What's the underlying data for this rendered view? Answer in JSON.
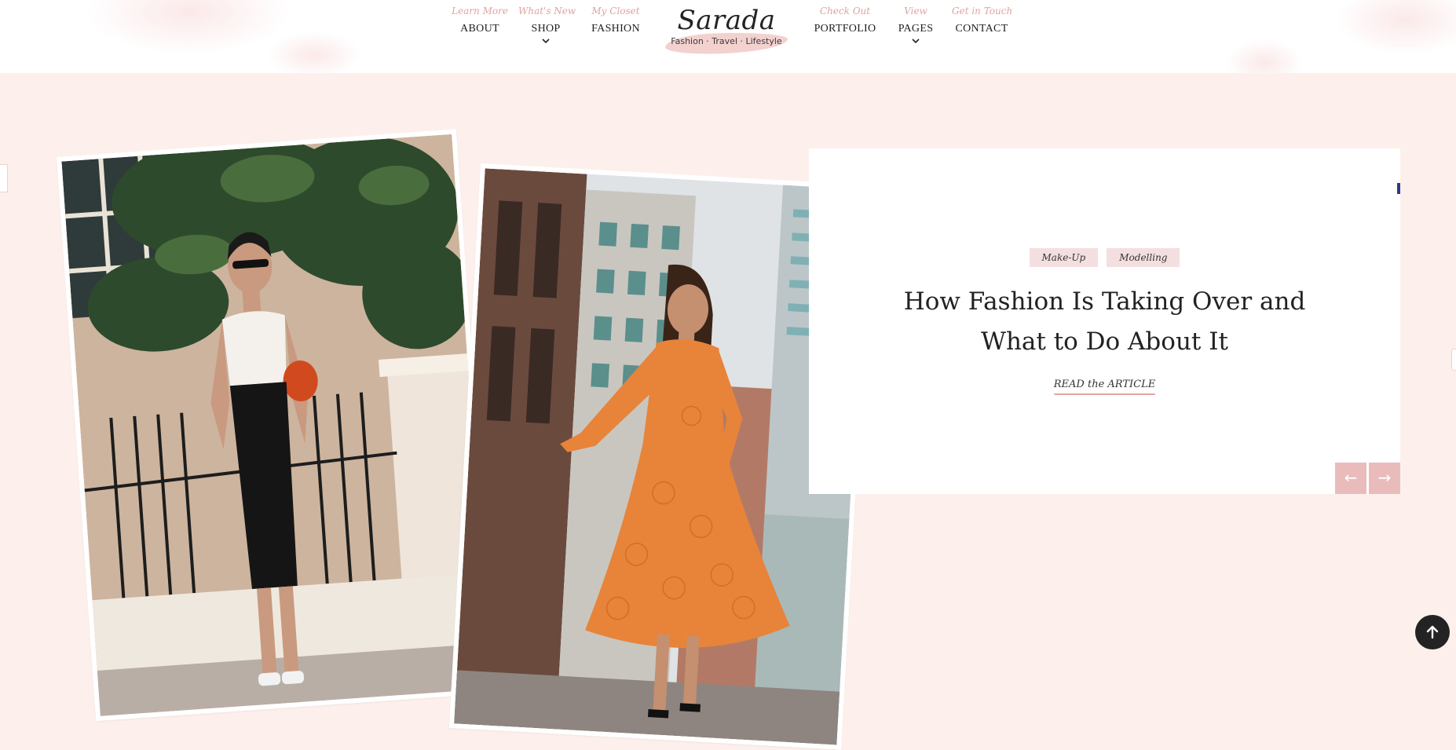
{
  "nav": {
    "items_left": [
      {
        "kicker": "Learn More",
        "label": "ABOUT",
        "has_dropdown": false
      },
      {
        "kicker": "What's New",
        "label": "SHOP",
        "has_dropdown": true
      },
      {
        "kicker": "My Closet",
        "label": "FASHION",
        "has_dropdown": false
      }
    ],
    "items_right": [
      {
        "kicker": "Check Out",
        "label": "PORTFOLIO",
        "has_dropdown": false
      },
      {
        "kicker": "View",
        "label": "PAGES",
        "has_dropdown": true
      },
      {
        "kicker": "Get in Touch",
        "label": "CONTACT",
        "has_dropdown": false
      }
    ],
    "icons": {
      "dropdown": "chevron-down-icon"
    }
  },
  "logo": {
    "name": "Sarada",
    "tagline": "Fashion · Travel · Lifestyle"
  },
  "feature": {
    "tags": [
      "Make-Up",
      "Modelling"
    ],
    "title_line1": "How Fashion Is Taking Over and",
    "title_line2": "What to Do About It",
    "read_link": "READ the ARTICLE",
    "prev_icon": "←",
    "next_icon": "→"
  },
  "colors": {
    "page_bg": "#fdf0ec",
    "accent_pink": "#e9bcbb",
    "tag_bg": "#f4dfe0",
    "kicker": "#e0a3a0",
    "dress_orange": "#e8833a",
    "to_top_bg": "#232323"
  },
  "scroll_top": {
    "icon": "arrow-up-icon"
  }
}
